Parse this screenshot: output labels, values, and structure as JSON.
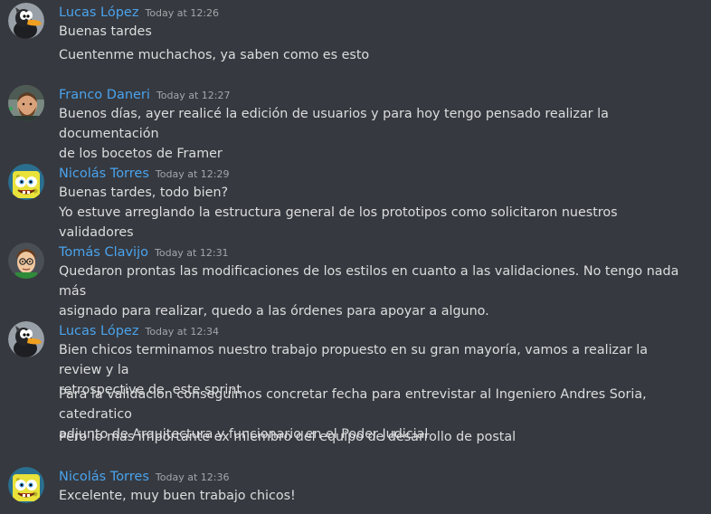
{
  "colors": {
    "background": "#36393f",
    "username": "#4aa3ed",
    "text": "#dcddde",
    "timestamp": "#a3a6aa"
  },
  "messages": [
    {
      "user": "Lucas López",
      "time": "Today at 12:26",
      "avatar": "duck-avatar-icon",
      "lines": [
        "Buenas tardes",
        "Cuentenme muchachos, ya saben como es esto"
      ]
    },
    {
      "user": "Franco Daneri",
      "time": "Today at 12:27",
      "avatar": "bearded-man-avatar-icon",
      "lines": [
        "Buenos días, ayer realicé la edición de usuarios y para hoy tengo pensado realizar la documentación\nde los bocetos de Framer"
      ]
    },
    {
      "user": "Nicolás Torres",
      "time": "Today at 12:29",
      "avatar": "sponge-avatar-icon",
      "lines": [
        "Buenas tardes, todo bien?\nYo estuve arreglando la estructura general de los prototipos como solicitaron nuestros validadores"
      ]
    },
    {
      "user": "Tomás Clavijo",
      "time": "Today at 12:31",
      "avatar": "cartoon-boy-avatar-icon",
      "lines": [
        "Quedaron prontas las modificaciones de los estilos en cuanto a las validaciones. No tengo nada más\nasignado para realizar, quedo a las órdenes para apoyar a alguno."
      ]
    },
    {
      "user": "Lucas López",
      "time": "Today at 12:34",
      "avatar": "duck-avatar-icon",
      "lines": [
        "Bien chicos terminamos nuestro trabajo propuesto en su gran mayoría, vamos a realizar la review y la\nretrospective de  este sprint",
        "Para la validacion conseguimos concretar fecha para entrevistar al Ingeniero Andres Soria, catedratico\nadjunto de Arquitectura y funcionario en el Poder Judicial",
        "Pero lo mas importante ex miembro del equipo de desarrollo de postal"
      ]
    },
    {
      "user": "Nicolás Torres",
      "time": "Today at 12:36",
      "avatar": "sponge-avatar-icon",
      "lines": [
        "Excelente, muy buen trabajo chicos!"
      ]
    }
  ]
}
